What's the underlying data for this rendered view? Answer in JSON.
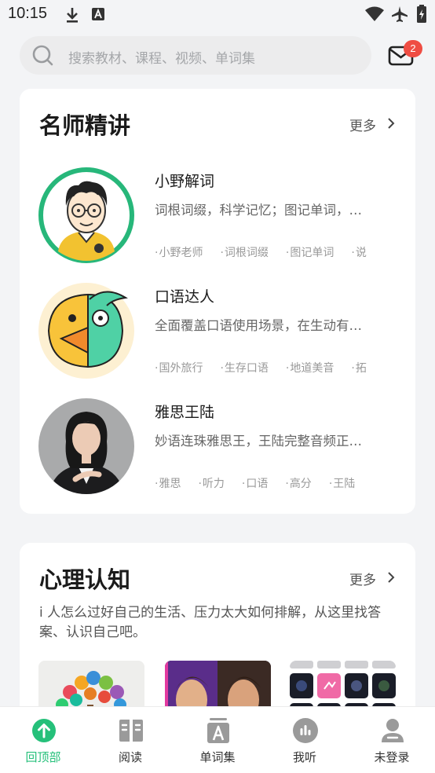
{
  "status_bar": {
    "time": "10:15"
  },
  "search": {
    "placeholder": "搜索教材、课程、视频、单词集"
  },
  "mail": {
    "badge_count": "2"
  },
  "teachers_section": {
    "title": "名师精讲",
    "more_label": "更多",
    "items": [
      {
        "name": "小野解词",
        "desc": "词根词缀，科学记忆；图记单词，…",
        "tags": [
          "小野老师",
          "词根词缀",
          "图记单词",
          "说"
        ]
      },
      {
        "name": "口语达人",
        "desc": "全面覆盖口语使用场景，在生动有…",
        "tags": [
          "国外旅行",
          "生存口语",
          "地道美音",
          "拓"
        ]
      },
      {
        "name": "雅思王陆",
        "desc": "妙语连珠雅思王，王陆完整音频正…",
        "tags": [
          "雅思",
          "听力",
          "口语",
          "高分",
          "王陆"
        ]
      }
    ]
  },
  "psych_section": {
    "title": "心理认知",
    "more_label": "更多",
    "desc": "i 人怎么过好自己的生活、压力太大如何排解，从这里找答案、认识自己吧。"
  },
  "bottom_nav": {
    "items": [
      {
        "label": "回顶部",
        "icon": "arrow-up-circle-icon"
      },
      {
        "label": "阅读",
        "icon": "book-icon"
      },
      {
        "label": "单词集",
        "icon": "word-set-icon"
      },
      {
        "label": "我听",
        "icon": "audio-bars-icon"
      },
      {
        "label": "未登录",
        "icon": "user-icon"
      }
    ]
  },
  "colors": {
    "accent": "#25c07a",
    "badge": "#ef4d43",
    "background": "#f3f4f6"
  }
}
